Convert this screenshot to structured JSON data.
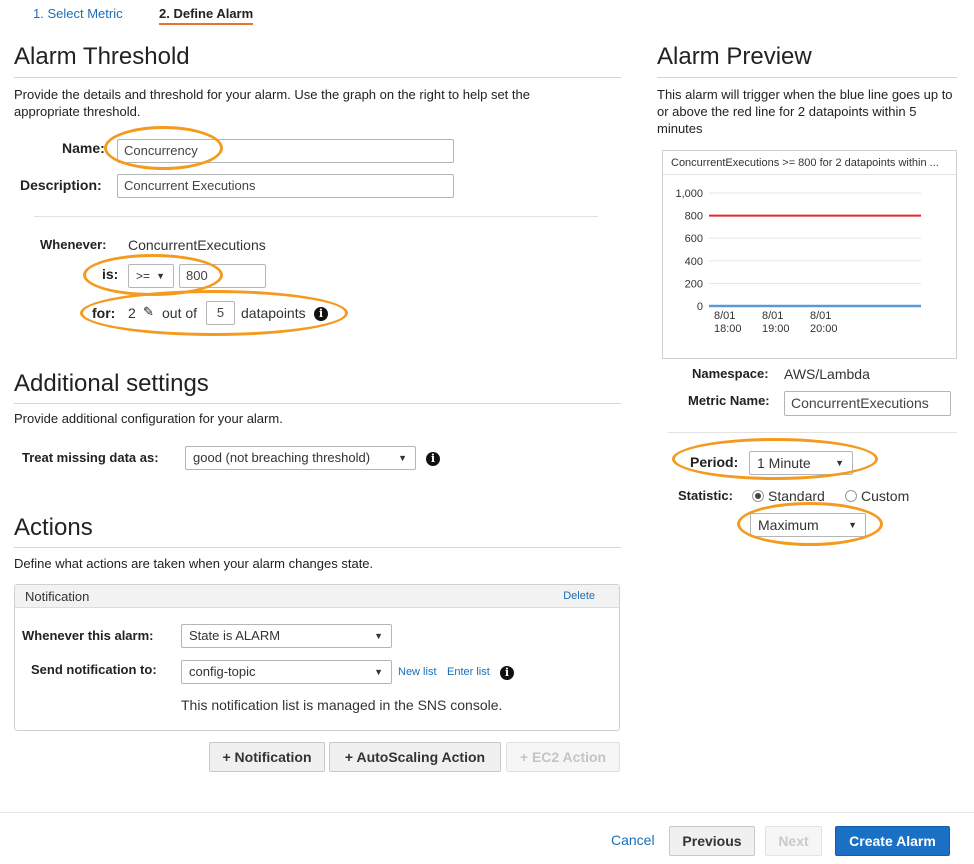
{
  "steps": {
    "step1": "1. Select Metric",
    "step2": "2. Define Alarm"
  },
  "threshold": {
    "title": "Alarm Threshold",
    "desc": "Provide the details and threshold for your alarm. Use the graph on the right to help set the appropriate threshold.",
    "name_label": "Name:",
    "name_value": "Concurrency",
    "description_label": "Description:",
    "description_value": "Concurrent Executions",
    "whenever_label": "Whenever:",
    "whenever_metric": "ConcurrentExecutions",
    "is_label": "is:",
    "operator": ">=",
    "threshold_value": "800",
    "for_label": "for:",
    "for_count": "2",
    "out_of_text": "out of",
    "out_of_value": "5",
    "datapoints_text": "datapoints"
  },
  "additional": {
    "title": "Additional settings",
    "desc": "Provide additional configuration for your alarm.",
    "missing_label": "Treat missing data as:",
    "missing_value": "good (not breaching threshold)"
  },
  "actions": {
    "title": "Actions",
    "desc": "Define what actions are taken when your alarm changes state.",
    "panel_title": "Notification",
    "delete_label": "Delete",
    "whenever_label": "Whenever this alarm:",
    "whenever_value": "State is ALARM",
    "send_label": "Send notification to:",
    "send_value": "config-topic",
    "new_list": "New list",
    "enter_list": "Enter list",
    "note": "This notification list is managed in the SNS console.",
    "btn_notification": "+ Notification",
    "btn_autoscaling": "+ AutoScaling Action",
    "btn_ec2": "+ EC2 Action"
  },
  "preview": {
    "title": "Alarm Preview",
    "desc": "This alarm will trigger when the blue line goes up to or above the red line for 2 datapoints within 5 minutes",
    "chart_title": "ConcurrentExecutions >= 800 for 2 datapoints within ...",
    "namespace_label": "Namespace:",
    "namespace_value": "AWS/Lambda",
    "metric_label": "Metric Name:",
    "metric_value": "ConcurrentExecutions",
    "period_label": "Period:",
    "period_value": "1 Minute",
    "statistic_label": "Statistic:",
    "standard_label": "Standard",
    "custom_label": "Custom",
    "statistic_value": "Maximum"
  },
  "chart_data": {
    "type": "line",
    "title": "ConcurrentExecutions >= 800 for 2 datapoints within ...",
    "y_ticks": [
      "1,000",
      "800",
      "600",
      "400",
      "200",
      "0"
    ],
    "x_ticks": [
      [
        "8/01",
        "18:00"
      ],
      [
        "8/01",
        "19:00"
      ],
      [
        "8/01",
        "20:00"
      ]
    ],
    "ylim": [
      0,
      1000
    ],
    "threshold": 800,
    "series": [
      {
        "color": "#e8262b",
        "values": [
          800,
          800
        ]
      },
      {
        "color": "#5b9bd5",
        "values": [
          0,
          0
        ]
      }
    ]
  },
  "footer": {
    "cancel": "Cancel",
    "previous": "Previous",
    "next": "Next",
    "create": "Create Alarm"
  },
  "colors": {
    "accent": "#f39a1f",
    "primary": "#1a6fb8",
    "threshold_line": "#e8262b",
    "metric_line": "#5b9bd5"
  }
}
